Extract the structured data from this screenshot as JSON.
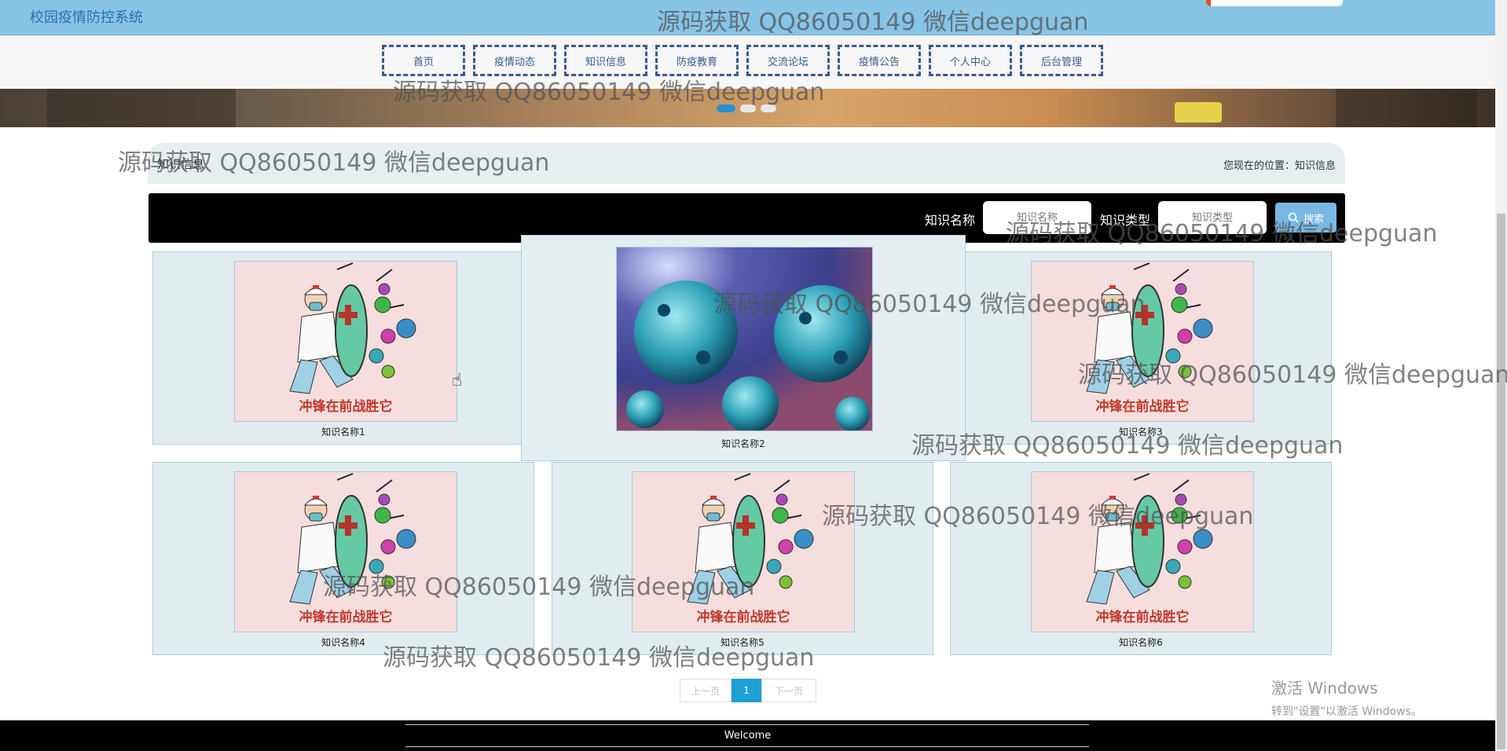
{
  "header": {
    "site_title": "校园疫情防控系统"
  },
  "nav": {
    "items": [
      "首页",
      "疫情动态",
      "知识信息",
      "防疫教育",
      "交流论坛",
      "疫情公告",
      "个人中心",
      "后台管理"
    ]
  },
  "location": {
    "title": "知识信息",
    "breadcrumb": "您现在的位置：知识信息"
  },
  "search": {
    "name_label": "知识名称",
    "name_placeholder": "知识名称",
    "type_label": "知识类型",
    "type_placeholder": "知识类型",
    "button_label": "搜索"
  },
  "cards": [
    {
      "name": "知识名称1",
      "image": "doctor-shield-poster"
    },
    {
      "name": "知识名称2",
      "image": "virus-3d-render"
    },
    {
      "name": "知识名称3",
      "image": "doctor-shield-poster"
    },
    {
      "name": "知识名称4",
      "image": "doctor-shield-poster"
    },
    {
      "name": "知识名称5",
      "image": "doctor-shield-poster"
    },
    {
      "name": "知识名称6",
      "image": "doctor-shield-poster"
    }
  ],
  "poster_caption": "冲锋在前战胜它",
  "pagination": {
    "prev": "上一页",
    "current": "1",
    "next": "下一页"
  },
  "footer": {
    "text": "Welcome"
  },
  "watermark": "源码获取 QQ86050149 微信deepguan",
  "os_overlay": {
    "line1": "激活 Windows",
    "line2": "转到\"设置\"以激活 Windows。"
  },
  "colors": {
    "header_bg": "#87c4e6",
    "nav_border": "#3a5b8c",
    "accent": "#1e9fd6",
    "card_bg": "#e1ecee"
  }
}
